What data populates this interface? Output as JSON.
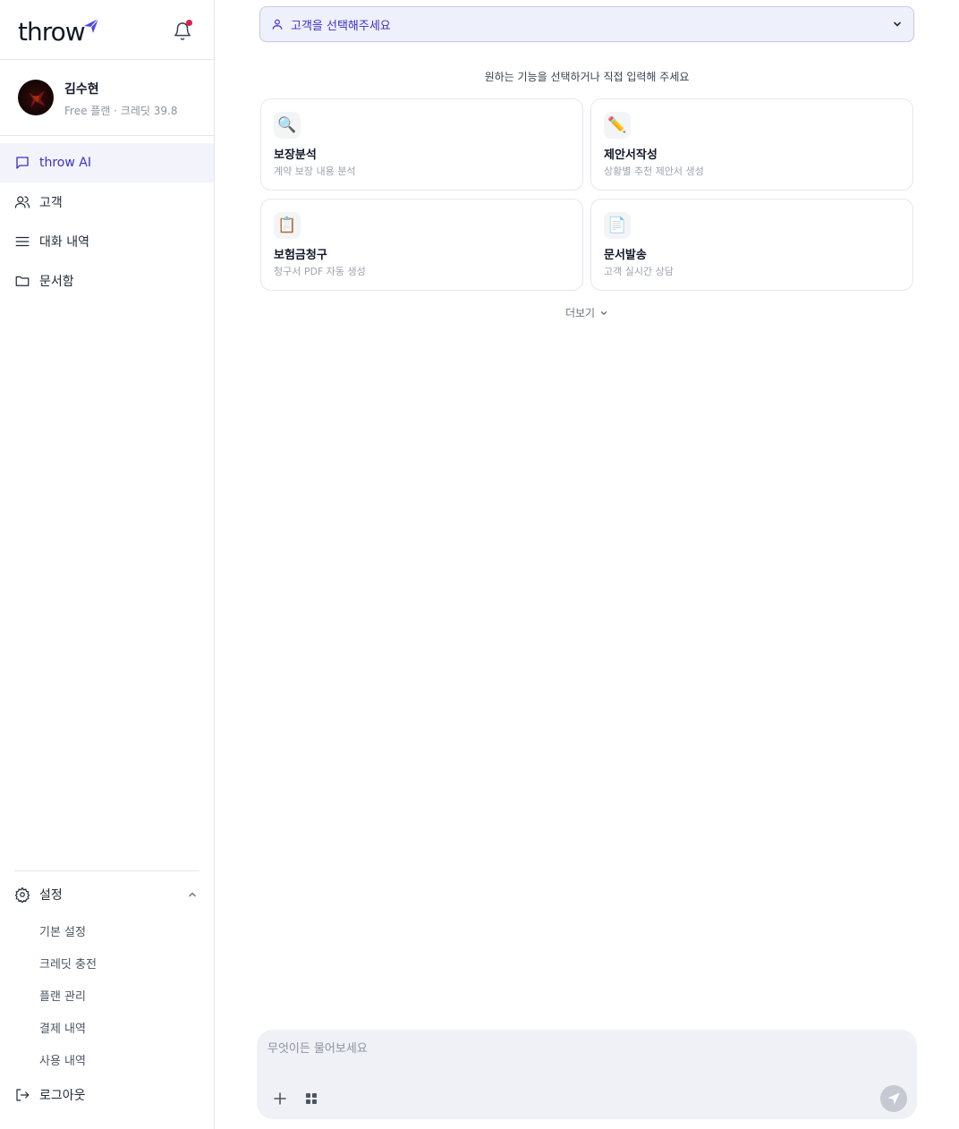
{
  "brand": {
    "name": "throw"
  },
  "profile": {
    "name": "김수현",
    "plan_text": "Free 플랜 · 크레딧 39.8"
  },
  "nav": [
    {
      "label": "throw AI",
      "icon": "chat-bubble-icon",
      "active": true
    },
    {
      "label": "고객",
      "icon": "users-icon",
      "active": false
    },
    {
      "label": "대화 내역",
      "icon": "menu-lines-icon",
      "active": false
    },
    {
      "label": "문서함",
      "icon": "folder-icon",
      "active": false
    }
  ],
  "settings": {
    "label": "설정",
    "expanded": true,
    "items": [
      "기본 설정",
      "크레딧 충전",
      "플랜 관리",
      "결제 내역",
      "사용 내역"
    ]
  },
  "logout_label": "로그아웃",
  "customer_select": {
    "placeholder": "고객을 선택해주세요"
  },
  "prompt_title": "원하는 기능을 선택하거나 직접 입력해 주세요",
  "features": [
    {
      "icon": "🔍",
      "icon_name": "magnifier-icon",
      "title": "보장분석",
      "desc": "계약 보장 내용 분석"
    },
    {
      "icon": "✏️",
      "icon_name": "pencil-icon",
      "title": "제안서작성",
      "desc": "상황별 추천 제안서 생성"
    },
    {
      "icon": "📋",
      "icon_name": "clipboard-icon",
      "title": "보험금청구",
      "desc": "청구서 PDF 자동 생성"
    },
    {
      "icon": "📄",
      "icon_name": "document-icon",
      "title": "문서발송",
      "desc": "고객 실시간 상담"
    }
  ],
  "more_label": "더보기",
  "composer": {
    "placeholder": "무엇이든 물어보세요"
  },
  "colors": {
    "accent": "#3b2fc9",
    "notification_dot": "#e11d48",
    "select_bg": "#eef0fc",
    "composer_bg": "#f0f1f6"
  }
}
